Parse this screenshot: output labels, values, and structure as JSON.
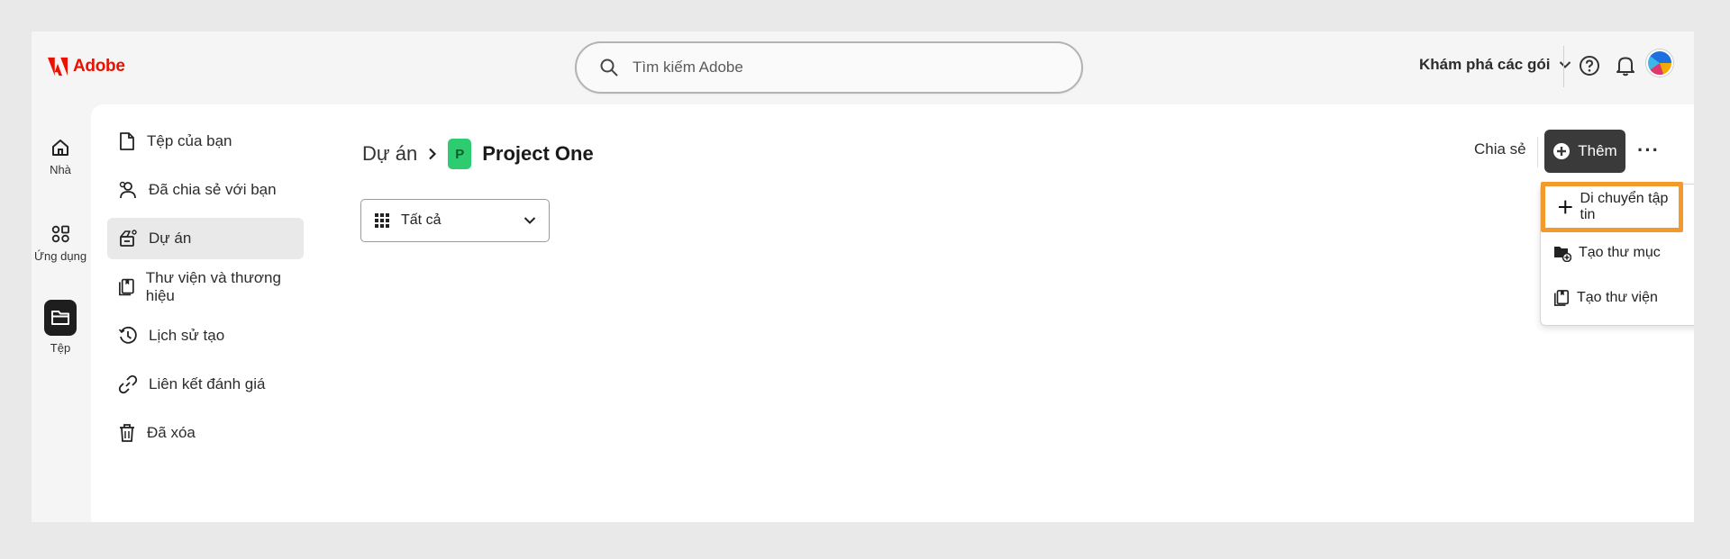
{
  "brand": {
    "name": "Adobe",
    "color": "#eb1000"
  },
  "search": {
    "placeholder": "Tìm kiếm Adobe"
  },
  "header": {
    "plans_label": "Khám phá các gói"
  },
  "rail": {
    "items": [
      {
        "label": "Nhà",
        "icon": "home-icon"
      },
      {
        "label": "Ứng dụng",
        "icon": "apps-icon"
      },
      {
        "label": "Tệp",
        "icon": "folder-icon",
        "active": true
      }
    ]
  },
  "sidebar": {
    "items": [
      {
        "label": "Tệp của bạn",
        "icon": "file-icon"
      },
      {
        "label": "Đã chia sẻ với bạn",
        "icon": "people-icon"
      },
      {
        "label": "Dự án",
        "icon": "project-icon",
        "active": true
      },
      {
        "label": "Thư viện và thương hiệu",
        "icon": "library-icon"
      },
      {
        "label": "Lịch sử tạo",
        "icon": "history-icon"
      },
      {
        "label": "Liên kết đánh giá",
        "icon": "link-icon"
      },
      {
        "label": "Đã xóa",
        "icon": "trash-icon"
      }
    ]
  },
  "breadcrumb": {
    "parent": "Dự án",
    "project_initial": "P",
    "project_name": "Project One"
  },
  "filter": {
    "selected": "Tất cả"
  },
  "toolbar": {
    "share_label": "Chia sẻ",
    "add_label": "Thêm",
    "more_label": "···"
  },
  "add_menu": {
    "items": [
      {
        "label": "Di chuyển tập tin",
        "icon": "plus-icon",
        "highlighted": true
      },
      {
        "label": "Tạo thư mục",
        "icon": "new-folder-icon"
      },
      {
        "label": "Tạo thư viện",
        "icon": "library-icon"
      }
    ],
    "highlight_color": "#f39a2b"
  }
}
